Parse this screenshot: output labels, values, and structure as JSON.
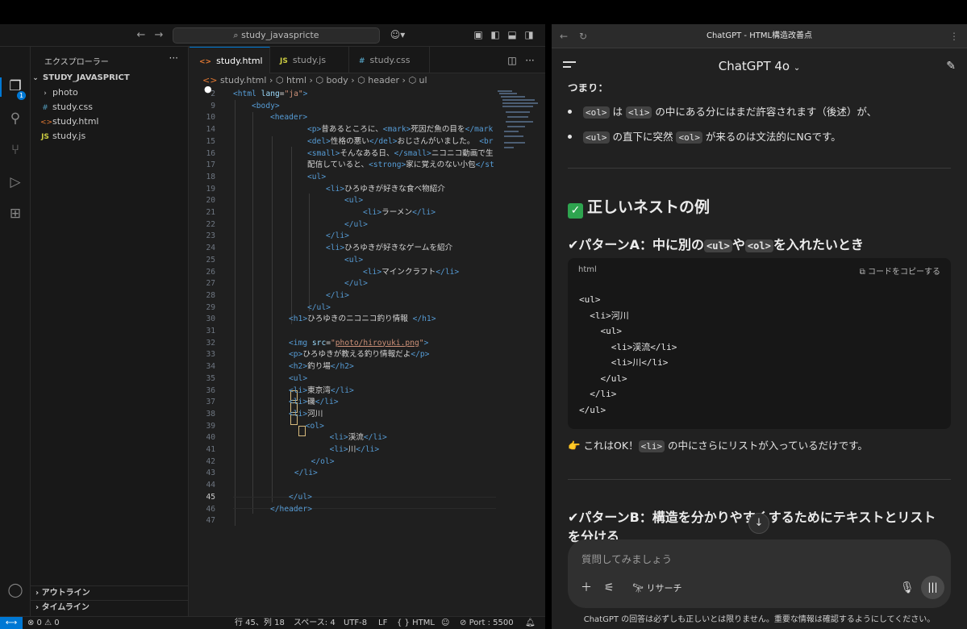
{
  "vscode": {
    "search": "study_javaspricte",
    "explorer_title": "エクスプローラー",
    "project": "STUDY_JAVASPRICT",
    "files": [
      {
        "name": "photo",
        "icon": "›",
        "type": "folder"
      },
      {
        "name": "study.css",
        "icon": "#",
        "type": "css"
      },
      {
        "name": "study.html",
        "icon": "<>",
        "type": "html"
      },
      {
        "name": "study.js",
        "icon": "JS",
        "type": "js"
      }
    ],
    "outline": "アウトライン",
    "timeline": "タイムライン",
    "badge": "1",
    "tabs": [
      {
        "label": "study.html",
        "icon": "<>",
        "modified": "●"
      },
      {
        "label": "study.js",
        "icon": "JS"
      },
      {
        "label": "study.css",
        "icon": "#"
      }
    ],
    "breadcrumb": [
      "study.html",
      "html",
      "body",
      "header",
      "ul"
    ],
    "status": {
      "problems": "⊗ 0 ⚠ 0",
      "position": "行 45、列 18",
      "spaces": "スペース: 4",
      "encoding": "UTF-8",
      "eol": "LF",
      "language": "{ } HTML",
      "port": "Port : 5500"
    }
  },
  "chat": {
    "window_title": "ChatGPT - HTML構造改善点",
    "model": "ChatGPT 4o",
    "partial_heading": "つまり：",
    "bullet1": {
      "code1": "<ol>",
      "t1": " は ",
      "code2": "<li>",
      "t2": " の中にある分にはまだ許容されます（後述）が、"
    },
    "bullet2": {
      "code1": "<ul>",
      "t1": " の直下に突然 ",
      "code2": "<ol>",
      "t2": " が来るのは文法的にNGです。"
    },
    "section_title": "正しいネストの例",
    "patternA": {
      "prefix": "✔︎パターンA：中に別の",
      "code1": "<ul>",
      "mid": "や",
      "code2": "<ol>",
      "suffix": "を入れたいとき"
    },
    "codeblock": {
      "lang": "html",
      "copy": "コードをコピーする",
      "lines": [
        "<ul>",
        "  <li>河川",
        "    <ul>",
        "      <li>渓流</li>",
        "      <li>川</li>",
        "    </ul>",
        "  </li>",
        "</ul>"
      ]
    },
    "note": {
      "prefix": "👉 これはOK！",
      "code": "<li>",
      "suffix": " の中にさらにリストが入っているだけです。"
    },
    "patternB_line1": "✔︎パターンB：構造を分かりやすくするためにテキストとリスト",
    "patternB_line2": "を分ける",
    "composer_placeholder": "質問してみましょう",
    "research": "リサーチ",
    "disclaimer": "ChatGPT の回答は必ずしも正しいとは限りません。重要な情報は確認するようにしてください。"
  }
}
